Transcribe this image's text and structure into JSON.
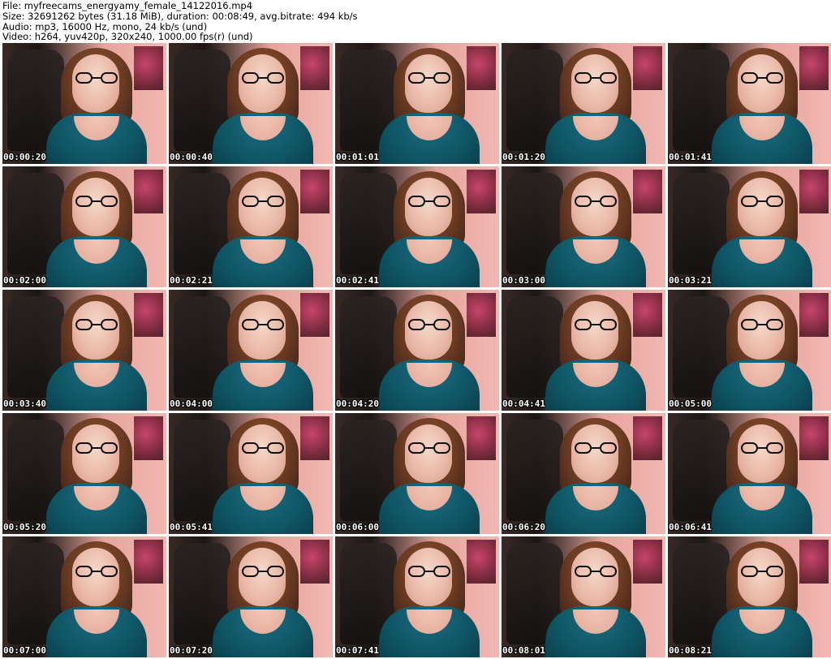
{
  "header": {
    "file_line": "File: myfreecams_energyamy_female_14122016.mp4",
    "size_line": "Size: 32691262 bytes (31.18 MiB), duration: 00:08:49, avg.bitrate: 494 kb/s",
    "audio_line": "Audio: mp3, 16000 Hz, mono, 24 kb/s (und)",
    "video_line": "Video: h264, yuv420p, 320x240, 1000.00 fps(r) (und)"
  },
  "thumbnails": [
    {
      "timestamp": "00:00:20"
    },
    {
      "timestamp": "00:00:40"
    },
    {
      "timestamp": "00:01:01"
    },
    {
      "timestamp": "00:01:20"
    },
    {
      "timestamp": "00:01:41"
    },
    {
      "timestamp": "00:02:00"
    },
    {
      "timestamp": "00:02:21"
    },
    {
      "timestamp": "00:02:41"
    },
    {
      "timestamp": "00:03:00"
    },
    {
      "timestamp": "00:03:21"
    },
    {
      "timestamp": "00:03:40"
    },
    {
      "timestamp": "00:04:00"
    },
    {
      "timestamp": "00:04:20"
    },
    {
      "timestamp": "00:04:41"
    },
    {
      "timestamp": "00:05:00"
    },
    {
      "timestamp": "00:05:20"
    },
    {
      "timestamp": "00:05:41"
    },
    {
      "timestamp": "00:06:00"
    },
    {
      "timestamp": "00:06:20"
    },
    {
      "timestamp": "00:06:41"
    },
    {
      "timestamp": "00:07:00"
    },
    {
      "timestamp": "00:07:20"
    },
    {
      "timestamp": "00:07:41"
    },
    {
      "timestamp": "00:08:01"
    },
    {
      "timestamp": "00:08:21"
    }
  ]
}
